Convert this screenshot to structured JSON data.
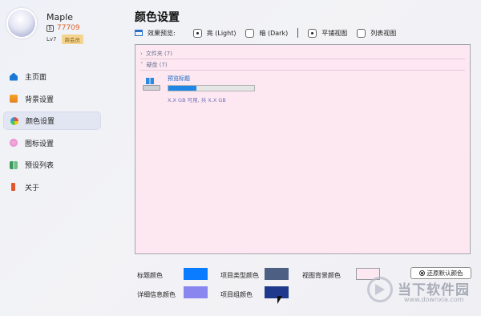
{
  "user": {
    "name": "Maple",
    "coins": "77709",
    "level": "Lv7",
    "badge": "商会员"
  },
  "sidebar": {
    "items": [
      {
        "label": "主页面",
        "icon": "home-icon",
        "active": false
      },
      {
        "label": "背景设置",
        "icon": "folder-icon",
        "active": false
      },
      {
        "label": "颜色设置",
        "icon": "color-wheel-icon",
        "active": true
      },
      {
        "label": "图标设置",
        "icon": "flower-icon",
        "active": false
      },
      {
        "label": "预设列表",
        "icon": "list-icon",
        "active": false
      },
      {
        "label": "关于",
        "icon": "info-icon",
        "active": false
      }
    ]
  },
  "main": {
    "title": "颜色设置",
    "preview": {
      "label": "效果预览:",
      "options": [
        {
          "label": "亮 (Light)",
          "checked": true
        },
        {
          "label": "暗 (Dark)",
          "checked": false
        },
        {
          "label": "平铺视图",
          "checked": true
        },
        {
          "label": "列表视图",
          "checked": false
        }
      ]
    },
    "explorer": {
      "folders_row": "文件夹 (7)",
      "drives_row": "硬盘 (7)",
      "drive_title": "预览标题",
      "drive_usage_percent": 33,
      "drive_detail": "X.X GB 可用, 共 X.X GB"
    }
  },
  "colors": {
    "title_color": {
      "label": "标题颜色",
      "value": "#0a7cff"
    },
    "detail_color": {
      "label": "详细信息颜色",
      "value": "#8a86f0"
    },
    "type_color": {
      "label": "项目类型颜色",
      "value": "#4d5f82"
    },
    "group_color": {
      "label": "项目组颜色",
      "value": "#1f3a8c"
    },
    "view_bg_color": {
      "label": "视图背景颜色",
      "value": "#fde8f2"
    },
    "reset_label": "还原默认颜色"
  },
  "watermark": {
    "brand": "当下软件园",
    "url": "www.downxia.com"
  }
}
